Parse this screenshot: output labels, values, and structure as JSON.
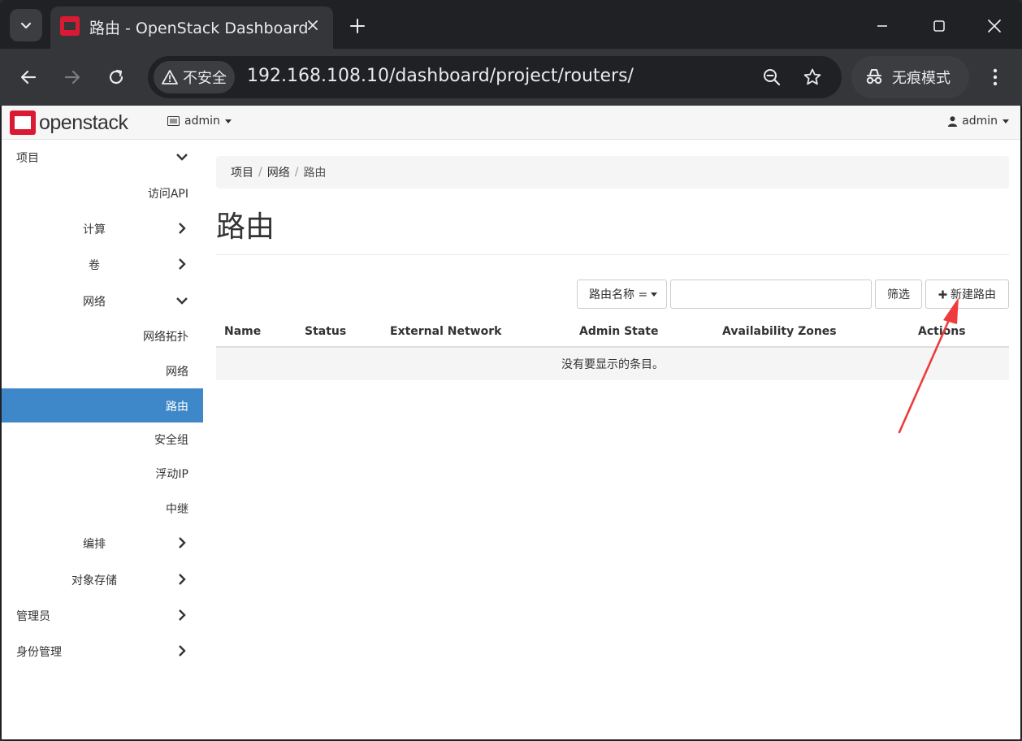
{
  "browser": {
    "tab_title": "路由 - OpenStack Dashboard",
    "security_label": "不安全",
    "url": "192.168.108.10/dashboard/project/routers/",
    "incognito_label": "无痕模式"
  },
  "header": {
    "logo_text": "openstack",
    "project_selector": "admin",
    "user_menu": "admin"
  },
  "sidebar": {
    "items": [
      {
        "label": "项目"
      },
      {
        "label": "访问API"
      },
      {
        "label": "计算"
      },
      {
        "label": "卷"
      },
      {
        "label": "网络"
      },
      {
        "label": "网络拓扑"
      },
      {
        "label": "网络"
      },
      {
        "label": "路由"
      },
      {
        "label": "安全组"
      },
      {
        "label": "浮动IP"
      },
      {
        "label": "中继"
      },
      {
        "label": "编排"
      },
      {
        "label": "对象存储"
      },
      {
        "label": "管理员"
      },
      {
        "label": "身份管理"
      }
    ]
  },
  "breadcrumb": [
    "项目",
    "网络",
    "路由"
  ],
  "page_title": "路由",
  "filter": {
    "field_select": "路由名称 =",
    "input_value": "",
    "filter_button": "筛选",
    "create_button": "新建路由"
  },
  "table": {
    "columns": [
      "Name",
      "Status",
      "External Network",
      "Admin State",
      "Availability Zones",
      "Actions"
    ],
    "empty_message": "没有要显示的条目。"
  },
  "colors": {
    "active_nav": "#3e88c9",
    "openstack_red": "#da1a32",
    "annotation_arrow": "#ee3b3b"
  }
}
